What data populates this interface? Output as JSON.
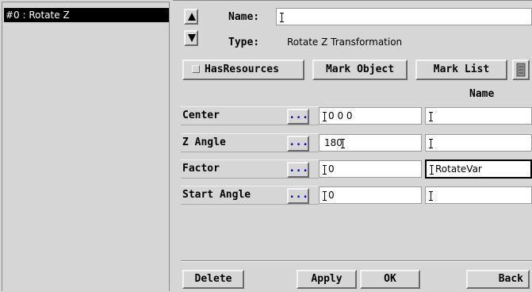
{
  "list": {
    "items": [
      {
        "label": "#0 : Rotate Z"
      }
    ]
  },
  "form": {
    "name_label": "Name:",
    "name_value": "",
    "type_label": "Type:",
    "type_value": "Rotate Z Transformation"
  },
  "toolbar": {
    "has_resources_label": "HasResources",
    "mark_object_label": "Mark Object",
    "mark_list_label": "Mark List"
  },
  "table": {
    "name_column_header": "Name",
    "rows": [
      {
        "label": "Center",
        "dots": "...",
        "value": "0 0 0",
        "name": ""
      },
      {
        "label": "Z Angle",
        "dots": "...",
        "value": "180",
        "name": ""
      },
      {
        "label": "Factor",
        "dots": "...",
        "value": "0",
        "name": "RotateVar"
      },
      {
        "label": "Start Angle",
        "dots": "...",
        "value": "0",
        "name": ""
      }
    ]
  },
  "footer": {
    "delete_label": "Delete",
    "apply_label": "Apply",
    "ok_label": "OK",
    "back_label": "Back"
  }
}
